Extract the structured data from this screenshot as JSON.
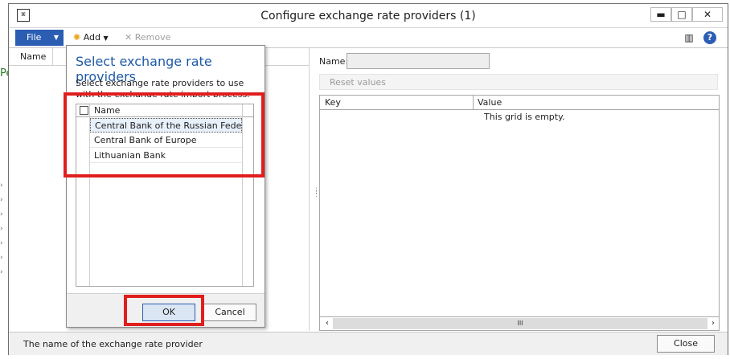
{
  "background": {
    "left_text": "Pe"
  },
  "window": {
    "title": "Configure exchange rate providers (1)",
    "minimize": "▬",
    "maximize": "□",
    "close": "✕"
  },
  "toolbar": {
    "file_label": "File",
    "add_label": "Add",
    "remove_label": "Remove"
  },
  "left_pane": {
    "column_header": "Name"
  },
  "right_pane": {
    "name_label": "Name:",
    "name_value": "",
    "reset_label": "Reset values",
    "grid": {
      "col_key": "Key",
      "col_value": "Value",
      "empty_text": "This grid is empty.",
      "scroll_thumb": "III"
    }
  },
  "dialog": {
    "title": "Select exchange rate providers",
    "description": "Select exchange rate providers to use with the exchange rate import process.",
    "column_header": "Name",
    "rows": [
      "Central Bank of the Russian Federa...",
      "Central Bank of Europe",
      "Lithuanian Bank"
    ],
    "ok_label": "OK",
    "cancel_label": "Cancel"
  },
  "status": {
    "text": "The name of the exchange rate provider",
    "close_label": "Close"
  },
  "colors": {
    "accent": "#2b5eb3",
    "highlight": "#e01e1e",
    "dialog_title": "#1f5aa6"
  }
}
